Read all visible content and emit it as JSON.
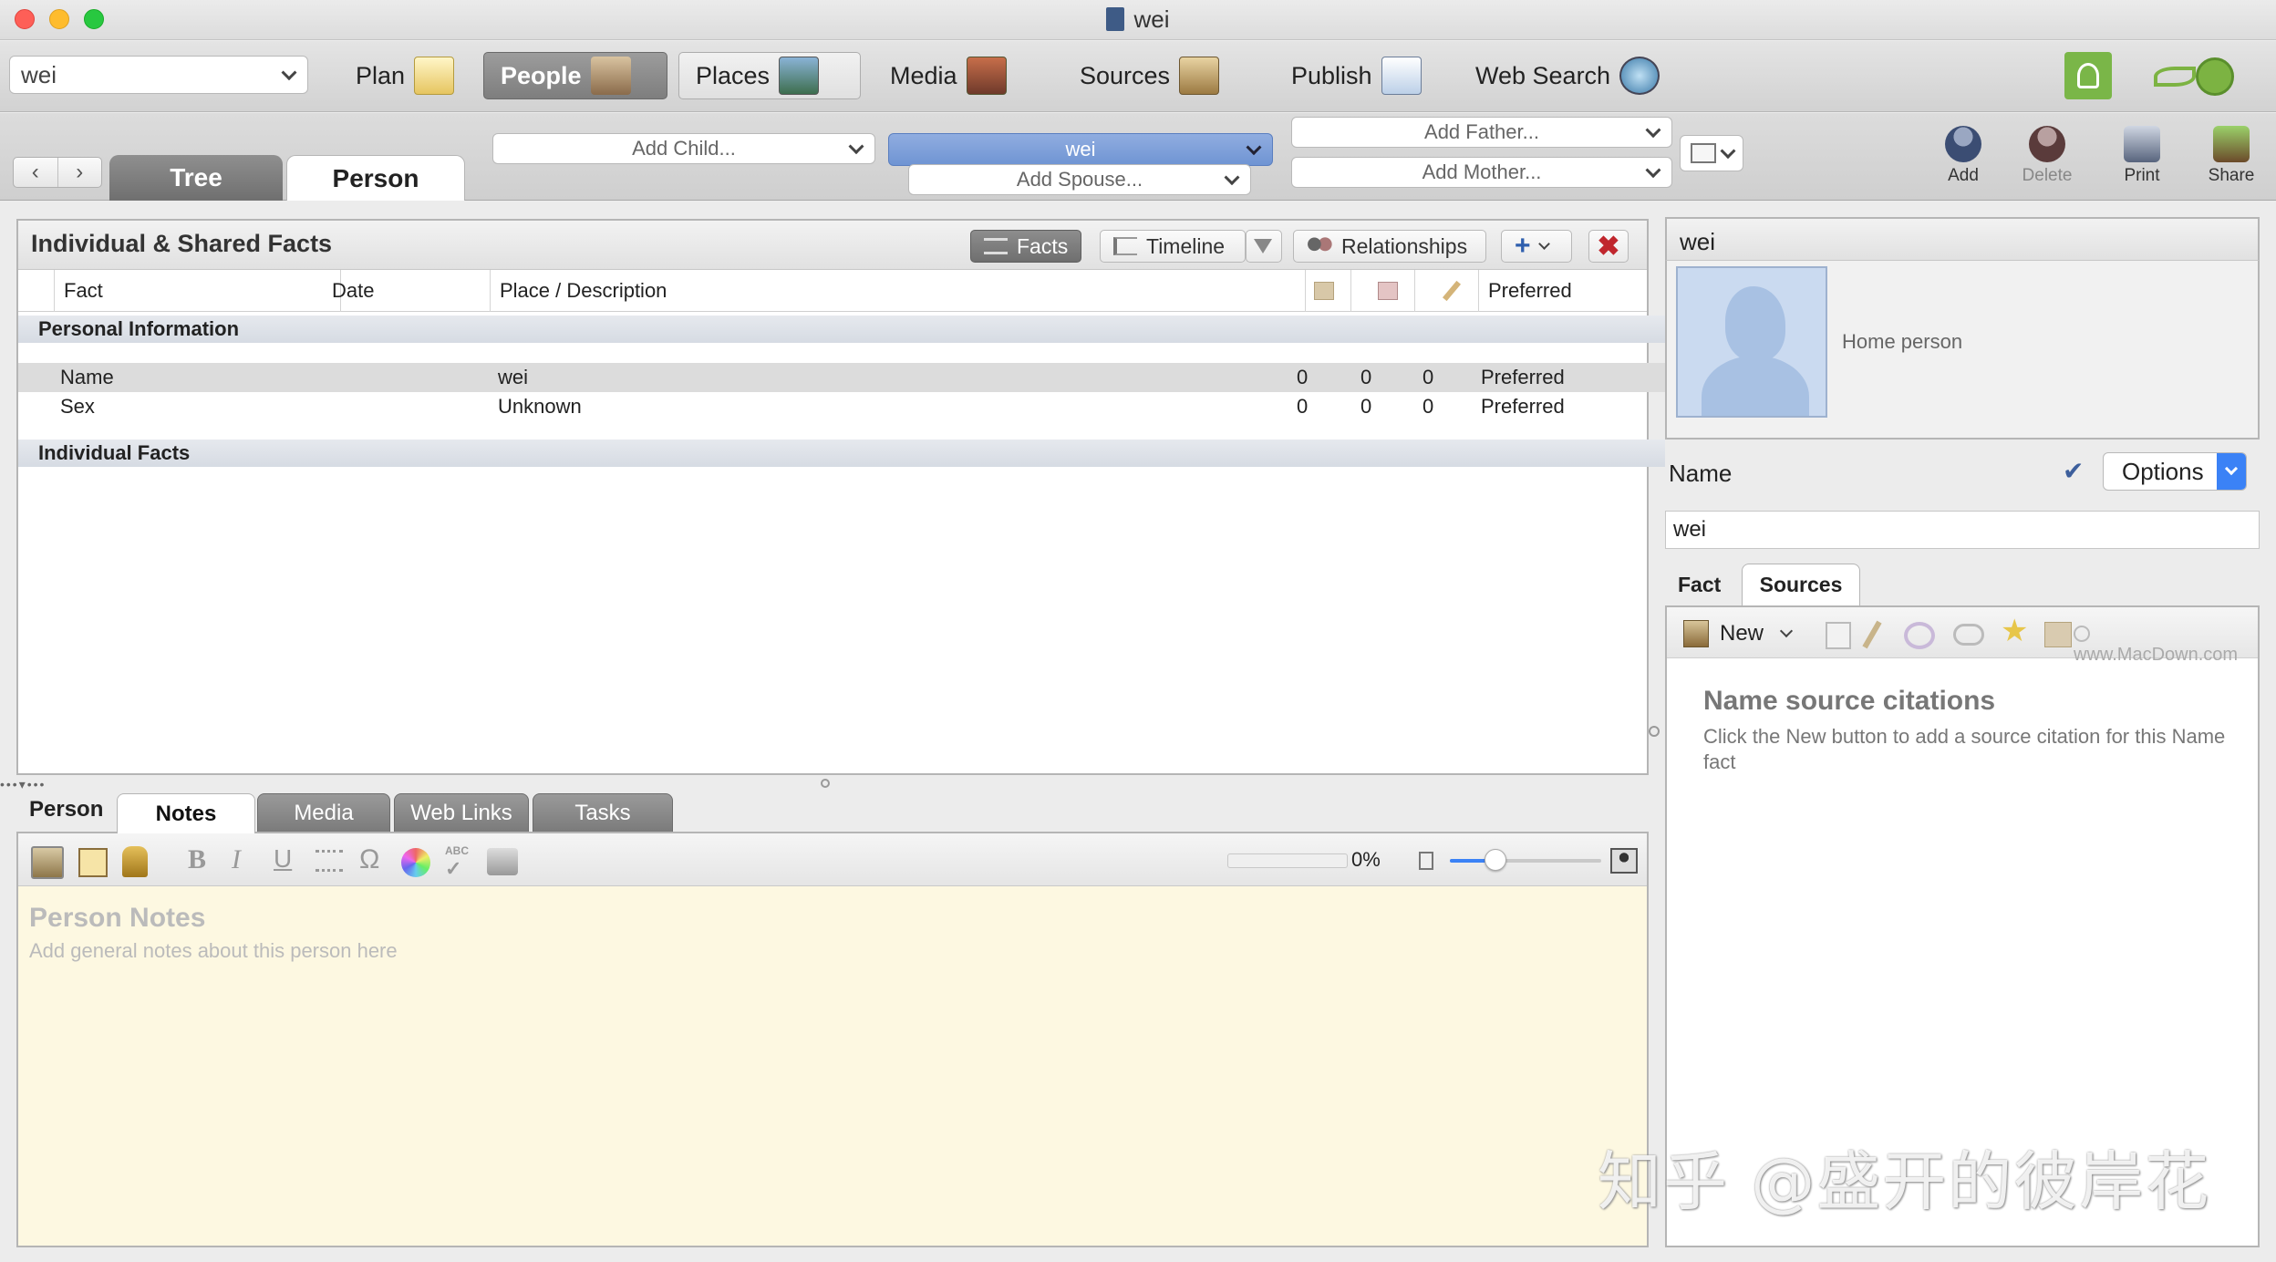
{
  "window": {
    "title": "wei"
  },
  "toolbar": {
    "tree_select": "wei",
    "plan": "Plan",
    "people": "People",
    "places": "Places",
    "media": "Media",
    "sources": "Sources",
    "publish": "Publish",
    "web_search": "Web Search"
  },
  "navbar": {
    "tabs": [
      "Tree",
      "Person"
    ],
    "add_child": "Add Child...",
    "current_person": "wei",
    "add_spouse": "Add Spouse...",
    "add_father": "Add Father...",
    "add_mother": "Add Mother...",
    "tools": [
      "Add",
      "Delete",
      "Print",
      "Share"
    ]
  },
  "facts_panel": {
    "title": "Individual & Shared Facts",
    "view_buttons": [
      "Facts",
      "Timeline",
      "Relationships"
    ],
    "columns": [
      "Fact",
      "Date",
      "Place / Description",
      "Preferred"
    ],
    "groups": [
      {
        "label": "Personal Information",
        "rows": [
          {
            "fact": "Name",
            "date": "",
            "place": "wei",
            "c1": "0",
            "c2": "0",
            "c3": "0",
            "preferred": "Preferred"
          },
          {
            "fact": "Sex",
            "date": "",
            "place": "Unknown",
            "c1": "0",
            "c2": "0",
            "c3": "0",
            "preferred": "Preferred"
          }
        ]
      },
      {
        "label": "Individual Facts",
        "rows": []
      }
    ]
  },
  "bottom_panel": {
    "label": "Person",
    "tabs": [
      "Notes",
      "Media",
      "Web Links",
      "Tasks"
    ],
    "progress_percent": "0%",
    "progress_value": 0,
    "zoom_fraction": 0.3,
    "notes_title": "Person Notes",
    "notes_hint": "Add general notes about this person here"
  },
  "right_panel": {
    "person_name": "wei",
    "home_person": "Home person",
    "name_label": "Name",
    "options": "Options",
    "name_value": "wei",
    "tabs": [
      "Fact",
      "Sources"
    ],
    "new_button": "New",
    "watermark_url": "www.MacDown.com",
    "citations_title": "Name source citations",
    "citations_hint": "Click the New button to add a source citation for this Name fact"
  },
  "overlay_watermark": "知乎 @盛开的彼岸花",
  "colors": {
    "accent": "#3b82f6",
    "notes_bg": "#fdf8e1",
    "group_bg": "#dbe0e8",
    "selected": "#7fa0d8"
  }
}
